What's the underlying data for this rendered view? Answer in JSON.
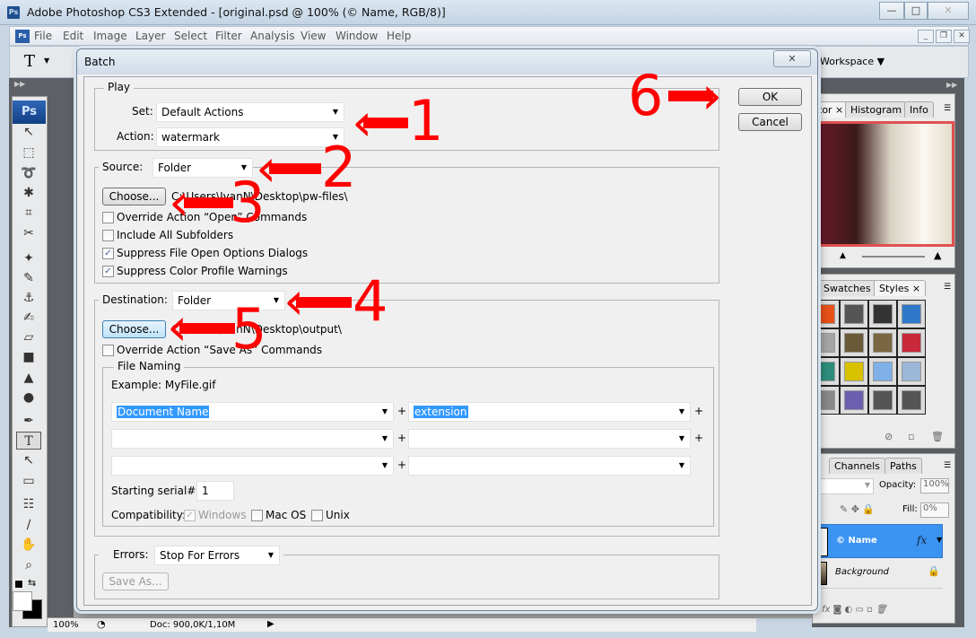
{
  "window": {
    "title": "Adobe Photoshop CS3 Extended - [original.psd @ 100% (© Name, RGB/8)]",
    "app_badge": "Ps",
    "controls": {
      "minimize": "—",
      "maximize": "□",
      "close": "✕"
    }
  },
  "menubar": {
    "items": [
      "File",
      "Edit",
      "Image",
      "Layer",
      "Select",
      "Filter",
      "Analysis",
      "View",
      "Window",
      "Help"
    ],
    "doc_controls": {
      "minimize": "_",
      "restore": "❐",
      "close": "✕"
    }
  },
  "optionsbar": {
    "tool_glyph": "T",
    "workspace_label": "Workspace ▼"
  },
  "toolbox": {
    "logo": "Ps",
    "tools": [
      {
        "name": "move-tool-icon",
        "glyph": "↖"
      },
      {
        "name": "marquee-tool-icon",
        "glyph": "⬚"
      },
      {
        "name": "lasso-tool-icon",
        "glyph": "➰"
      },
      {
        "name": "magic-wand-tool-icon",
        "glyph": "✱"
      },
      {
        "name": "crop-tool-icon",
        "glyph": "⌗"
      },
      {
        "name": "slice-tool-icon",
        "glyph": "✂"
      },
      {
        "name": "healing-brush-tool-icon",
        "glyph": "✦"
      },
      {
        "name": "brush-tool-icon",
        "glyph": "✎"
      },
      {
        "name": "clone-stamp-tool-icon",
        "glyph": "⚓"
      },
      {
        "name": "history-brush-tool-icon",
        "glyph": "✍"
      },
      {
        "name": "eraser-tool-icon",
        "glyph": "▱"
      },
      {
        "name": "gradient-tool-icon",
        "glyph": "■"
      },
      {
        "name": "blur-tool-icon",
        "glyph": "▲"
      },
      {
        "name": "dodge-tool-icon",
        "glyph": "●"
      },
      {
        "name": "pen-tool-icon",
        "glyph": "✒"
      },
      {
        "name": "type-tool-icon",
        "glyph": "T"
      },
      {
        "name": "path-selection-tool-icon",
        "glyph": "↖"
      },
      {
        "name": "shape-tool-icon",
        "glyph": "▭"
      },
      {
        "name": "notes-tool-icon",
        "glyph": "☷"
      },
      {
        "name": "eyedropper-tool-icon",
        "glyph": "∕"
      },
      {
        "name": "hand-tool-icon",
        "glyph": "✋"
      },
      {
        "name": "zoom-tool-icon",
        "glyph": "⌕"
      }
    ]
  },
  "statusbar": {
    "zoom": "100%",
    "doc_info": "Doc: 900,0K/1,10M"
  },
  "panels": {
    "navigator": {
      "tabs": [
        "tor ×",
        "Histogram",
        "Info"
      ]
    },
    "styles": {
      "tabs": [
        "Swatches",
        "Styles ×"
      ]
    },
    "layers": {
      "tabs": [
        "Channels",
        "Paths"
      ],
      "opacity_label": "Opacity:",
      "opacity_value": "100%",
      "fill_label": "Fill:",
      "fill_value": "0%",
      "layers": [
        {
          "name": "© Name",
          "fx": "fx",
          "selected": true
        },
        {
          "name": "Background",
          "locked": true,
          "selected": false
        }
      ]
    }
  },
  "dialog": {
    "title": "Batch",
    "close": "✕",
    "ok_label": "OK",
    "cancel_label": "Cancel",
    "play": {
      "legend": "Play",
      "set_label": "Set:",
      "set_value": "Default Actions",
      "action_label": "Action:",
      "action_value": "watermark"
    },
    "source": {
      "label": "Source:",
      "value": "Folder",
      "choose_label": "Choose...",
      "path": "C:\\Users\\IvanN\\Desktop\\pw-files\\",
      "options": [
        {
          "label": "Override Action “Open” Commands",
          "checked": false
        },
        {
          "label": "Include All Subfolders",
          "checked": false
        },
        {
          "label": "Suppress File Open Options Dialogs",
          "checked": true
        },
        {
          "label": "Suppress Color Profile Warnings",
          "checked": true
        }
      ]
    },
    "destination": {
      "label": "Destination:",
      "value": "Folder",
      "choose_label": "Choose...",
      "path": "C:\\Users\\IvanN\\Desktop\\output\\",
      "override_label": "Override Action “Save As” Commands",
      "override_checked": false,
      "file_naming": {
        "legend": "File Naming",
        "example": "Example: MyFile.gif",
        "fields": [
          [
            "Document Name",
            "extension"
          ],
          [
            "",
            ""
          ],
          [
            "",
            ""
          ]
        ],
        "serial_label": "Starting serial#:",
        "serial_value": "1",
        "compat_label": "Compatibility:",
        "compat": [
          {
            "label": "Windows",
            "checked": true,
            "disabled": true
          },
          {
            "label": "Mac OS",
            "checked": false
          },
          {
            "label": "Unix",
            "checked": false
          }
        ]
      }
    },
    "errors": {
      "label": "Errors:",
      "value": "Stop For Errors",
      "save_as_label": "Save As..."
    }
  },
  "annotations": [
    "1",
    "2",
    "3",
    "4",
    "5",
    "6"
  ],
  "colors": {
    "annotation": "#ff0000",
    "selection": "#3399ff",
    "ps_blue": "#1f4f8f"
  }
}
